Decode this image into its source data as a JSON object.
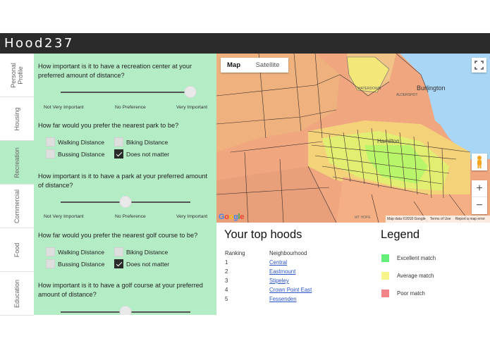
{
  "app": {
    "title": "Hood237"
  },
  "tabs": [
    {
      "label": "Personal Profile"
    },
    {
      "label": "Housing"
    },
    {
      "label": "Recreation"
    },
    {
      "label": "Commercial"
    },
    {
      "label": "Food"
    },
    {
      "label": "Education"
    }
  ],
  "active_tab": "Recreation",
  "recreation": {
    "q1": {
      "question": "How important is it to have a recreation center at your preferred amount of distance?",
      "slider_value": 1.0
    },
    "q2": {
      "question": "How far would you prefer the nearest park to be?",
      "options": [
        {
          "label": "Walking Distance",
          "checked": false
        },
        {
          "label": "Biking Distance",
          "checked": false
        },
        {
          "label": "Bussing Distance",
          "checked": false
        },
        {
          "label": "Does not matter",
          "checked": true
        }
      ]
    },
    "q3": {
      "question": "How important is it to have a park at your preferred amount of distance?",
      "slider_value": 0.5
    },
    "q4": {
      "question": "How far would you prefer the nearest golf course to be?",
      "options": [
        {
          "label": "Walking Distance",
          "checked": false
        },
        {
          "label": "Biking Distance",
          "checked": false
        },
        {
          "label": "Bussing Distance",
          "checked": false
        },
        {
          "label": "Does not matter",
          "checked": true
        }
      ]
    },
    "q5": {
      "question": "How important is it to have a golf course at your preferred amount of distance?",
      "slider_value": 0.5
    },
    "scale": {
      "left": "Not Very Important",
      "mid": "No Preference",
      "right": "Very Important"
    }
  },
  "map": {
    "map_label": "Map",
    "satellite_label": "Satellite",
    "city_label": "Burlington",
    "area_label": "Hamilton",
    "small_labels": [
      "WATERDOWN",
      "ALDERSHOT",
      "MT HOPE"
    ],
    "zoom_in": "+",
    "zoom_out": "−",
    "fullscreen_icon": "fullscreen-icon",
    "attribution": {
      "data": "Map data ©2018 Google",
      "terms": "Terms of Use",
      "report": "Report a map error"
    },
    "google_logo": "Google",
    "colors": {
      "water": "#a9d6f5",
      "excellent": "#b9f56a",
      "average": "#f2e384",
      "poor": "#f0a67e"
    }
  },
  "top_hoods": {
    "title": "Your top hoods",
    "col_rank": "Ranking",
    "col_name": "Neighbourhood",
    "rows": [
      {
        "rank": "1",
        "name": "Central"
      },
      {
        "rank": "2",
        "name": "Eastmount"
      },
      {
        "rank": "3",
        "name": "Stipeley"
      },
      {
        "rank": "4",
        "name": "Crown Point East"
      },
      {
        "rank": "5",
        "name": "Fessenden"
      }
    ]
  },
  "legend": {
    "title": "Legend",
    "items": [
      {
        "label": "Excellent match",
        "color": "#66ee7a"
      },
      {
        "label": "Average match",
        "color": "#f7f58a"
      },
      {
        "label": "Poor match",
        "color": "#f2858a"
      }
    ]
  }
}
